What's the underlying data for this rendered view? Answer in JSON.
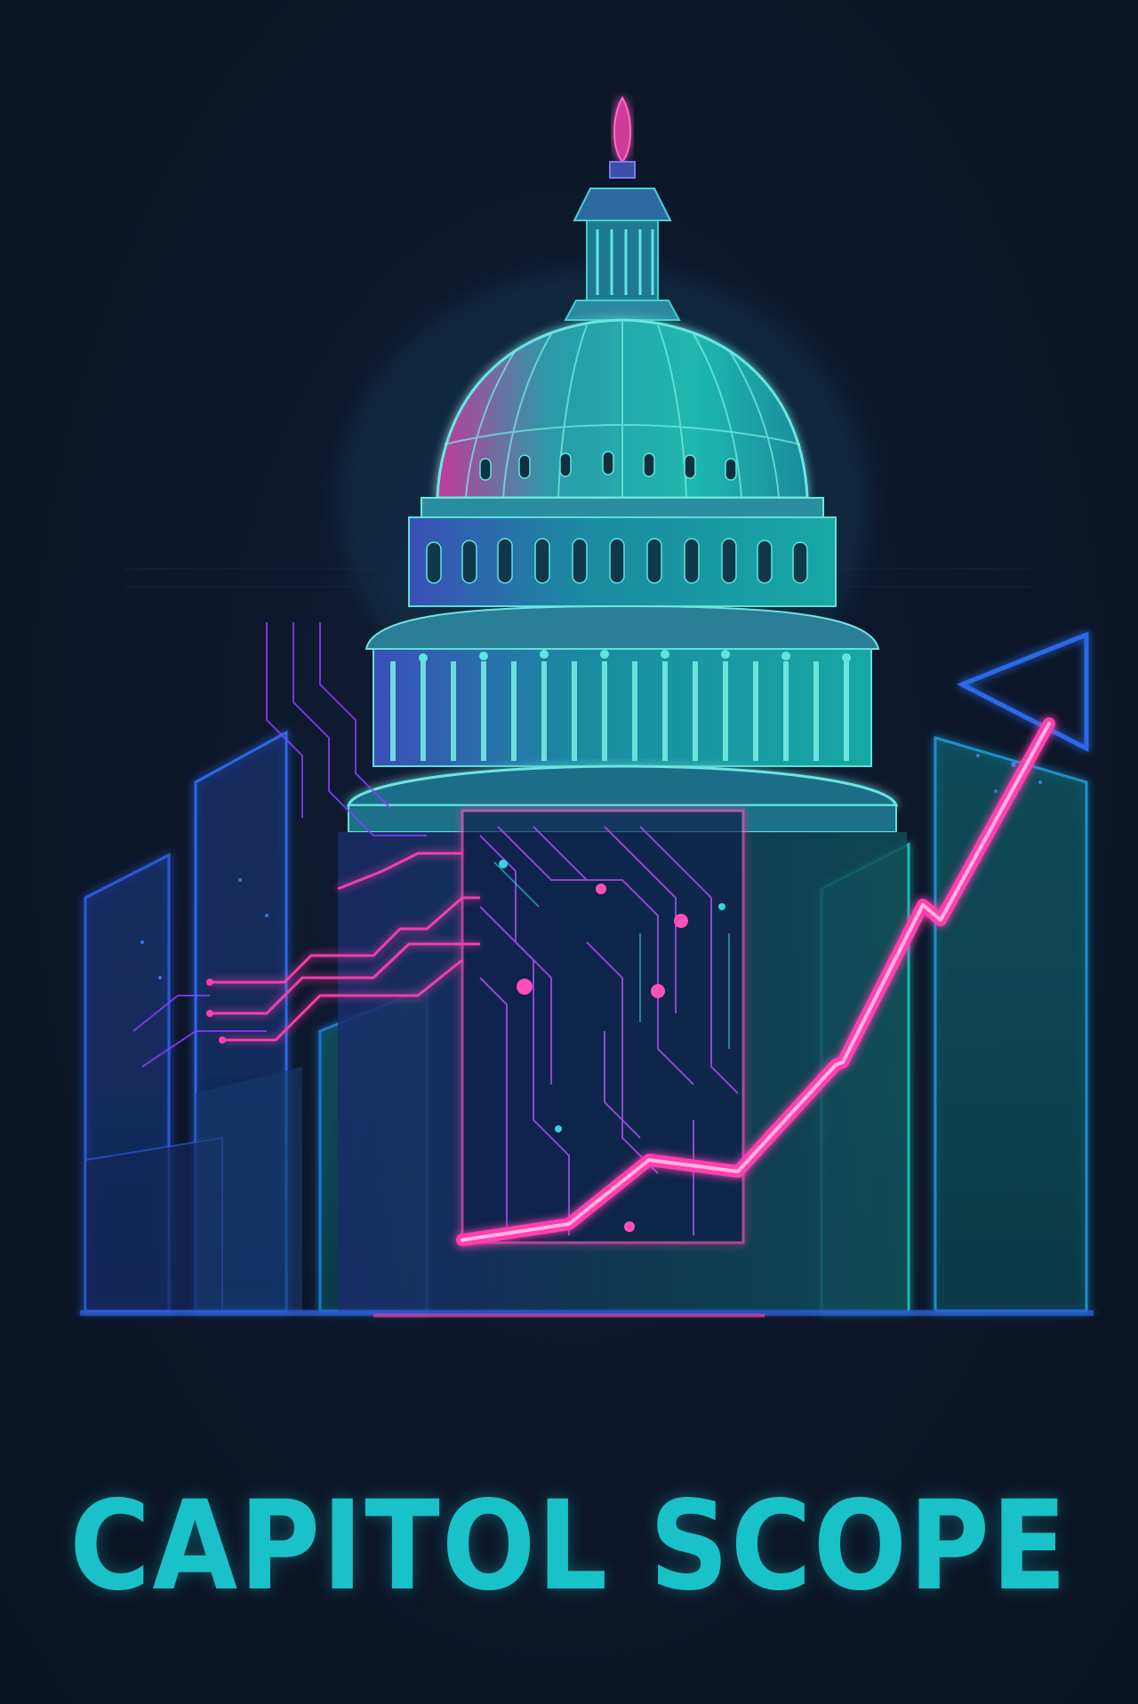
{
  "poster": {
    "title": "CAPITOL SCOPE"
  },
  "palette": {
    "background": "#0b1424",
    "teal": "#19c2c8",
    "cyan": "#2fe0d8",
    "blue": "#2a6ae8",
    "magenta": "#ff3fae",
    "purple": "#8a3cff"
  },
  "icons": {
    "dome": "capitol-dome-icon",
    "trend": "trend-arrow-icon",
    "bars": "bar-chart-icon",
    "circuit": "circuit-trace-icon"
  }
}
